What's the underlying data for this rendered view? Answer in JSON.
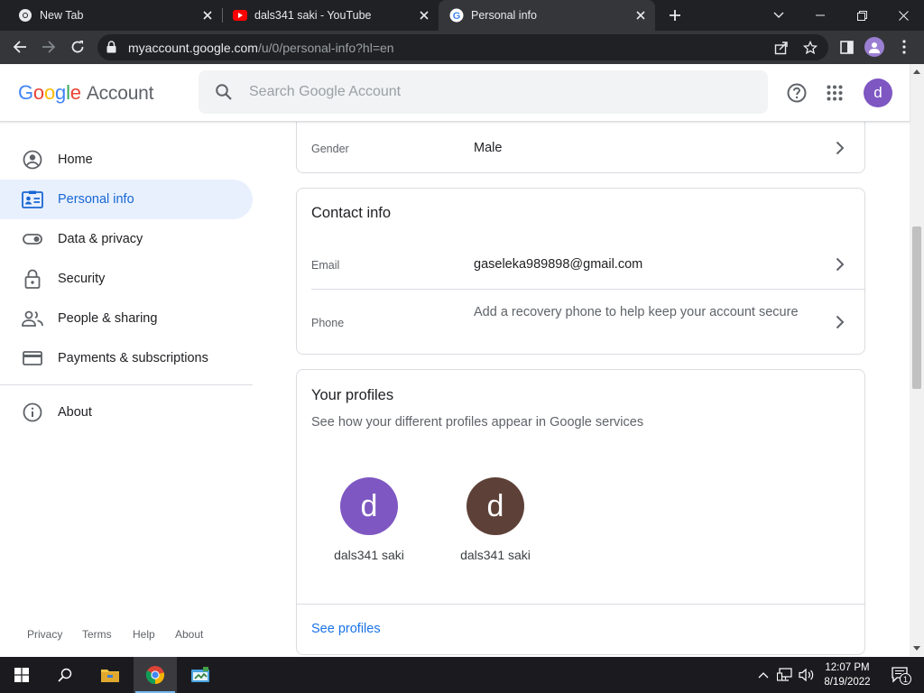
{
  "browser": {
    "tabs": [
      {
        "title": "New Tab",
        "favicon": "chrome-icon"
      },
      {
        "title": "dals341 saki - YouTube",
        "favicon": "youtube-icon"
      },
      {
        "title": "Personal info",
        "favicon": "google-icon",
        "active": true
      }
    ],
    "url_host": "myaccount.google.com",
    "url_path": "/u/0/personal-info?hl=en"
  },
  "header": {
    "logo_letters": [
      "G",
      "o",
      "o",
      "g",
      "l",
      "e"
    ],
    "logo_suffix": "Account",
    "search_placeholder": "Search Google Account",
    "avatar_letter": "d"
  },
  "sidebar": {
    "items": [
      {
        "label": "Home",
        "icon": "account-circle-icon"
      },
      {
        "label": "Personal info",
        "icon": "id-card-icon",
        "active": true
      },
      {
        "label": "Data & privacy",
        "icon": "toggle-icon"
      },
      {
        "label": "Security",
        "icon": "lock-icon"
      },
      {
        "label": "People & sharing",
        "icon": "people-icon"
      },
      {
        "label": "Payments & subscriptions",
        "icon": "credit-card-icon"
      },
      {
        "label": "About",
        "icon": "info-icon"
      }
    ],
    "footer": [
      "Privacy",
      "Terms",
      "Help",
      "About"
    ]
  },
  "basic_info": {
    "gender_label": "Gender",
    "gender_value": "Male"
  },
  "contact_info": {
    "title": "Contact info",
    "email_label": "Email",
    "email_value": "gaseleka989898@gmail.com",
    "phone_label": "Phone",
    "phone_value": "Add a recovery phone to help keep your account secure"
  },
  "profiles": {
    "title": "Your profiles",
    "subtitle": "See how your different profiles appear in Google services",
    "items": [
      {
        "letter": "d",
        "name": "dals341 saki",
        "color": "#7e57c2"
      },
      {
        "letter": "d",
        "name": "dals341 saki",
        "color": "#5d4037"
      }
    ],
    "see_profiles": "See profiles"
  },
  "taskbar": {
    "time": "12:07 PM",
    "date": "8/19/2022",
    "notification_count": "1"
  },
  "colors": {
    "google_blue": "#4285f4",
    "google_red": "#ea4335",
    "google_yellow": "#fbbc05",
    "google_green": "#34a853",
    "accent": "#1a73e8"
  }
}
